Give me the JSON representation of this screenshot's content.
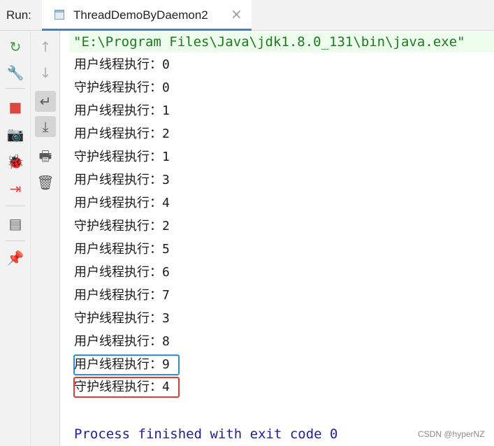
{
  "header": {
    "run_label": "Run:",
    "tab_title": "ThreadDemoByDaemon2",
    "tab_close": "×"
  },
  "left_toolbar": {
    "icons": [
      {
        "name": "rerun-icon",
        "glyph": "↻",
        "color": "#3f9c3f"
      },
      {
        "name": "wrench-icon",
        "glyph": "🔧",
        "color": "#5a5a5a"
      },
      {
        "name": "stop-icon",
        "glyph": "■",
        "color": "#d9473f"
      },
      {
        "name": "camera-icon",
        "glyph": "📷",
        "color": "#5a5a5a"
      },
      {
        "name": "debug-bug-icon",
        "glyph": "🐞",
        "color": "#3f9c3f"
      },
      {
        "name": "exit-icon",
        "glyph": "⇥",
        "color": "#d9473f"
      },
      {
        "name": "layout-icon",
        "glyph": "▤",
        "color": "#5a5a5a"
      },
      {
        "name": "pin-icon",
        "glyph": "📌",
        "color": "#5a5a5a"
      }
    ]
  },
  "mid_toolbar": {
    "icons": [
      {
        "name": "up-arrow-icon",
        "glyph": "↑",
        "color": "#b0b0b0"
      },
      {
        "name": "down-arrow-icon",
        "glyph": "↓",
        "color": "#b0b0b0"
      },
      {
        "name": "soft-wrap-icon",
        "glyph": "↵",
        "color": "#5a5a5a"
      },
      {
        "name": "scroll-to-end-icon",
        "glyph": "⤓",
        "color": "#5a5a5a"
      },
      {
        "name": "print-icon",
        "glyph": "🖶",
        "color": "#5a5a5a"
      },
      {
        "name": "trash-icon",
        "glyph": "🗑",
        "color": "#5a5a5a"
      }
    ]
  },
  "console": {
    "command": "\"E:\\Program Files\\Java\\jdk1.8.0_131\\bin\\java.exe\"",
    "lines": [
      {
        "label": "用户线程执行：",
        "value": "0"
      },
      {
        "label": "守护线程执行：",
        "value": "0"
      },
      {
        "label": "用户线程执行：",
        "value": "1"
      },
      {
        "label": "用户线程执行：",
        "value": "2"
      },
      {
        "label": "守护线程执行：",
        "value": "1"
      },
      {
        "label": "用户线程执行：",
        "value": "3"
      },
      {
        "label": "用户线程执行：",
        "value": "4"
      },
      {
        "label": "守护线程执行：",
        "value": "2"
      },
      {
        "label": "用户线程执行：",
        "value": "5"
      },
      {
        "label": "用户线程执行：",
        "value": "6"
      },
      {
        "label": "用户线程执行：",
        "value": "7"
      },
      {
        "label": "守护线程执行：",
        "value": "3"
      },
      {
        "label": "用户线程执行：",
        "value": "8"
      },
      {
        "label": "用户线程执行：",
        "value": "9"
      },
      {
        "label": "守护线程执行：",
        "value": "4"
      }
    ],
    "exit_message": "Process finished with exit code 0"
  },
  "watermark": "CSDN @hyperNZ",
  "colors": {
    "highlight_blue": "#2e8fe6",
    "highlight_red": "#e33b2f",
    "tab_accent": "#4083c9"
  }
}
